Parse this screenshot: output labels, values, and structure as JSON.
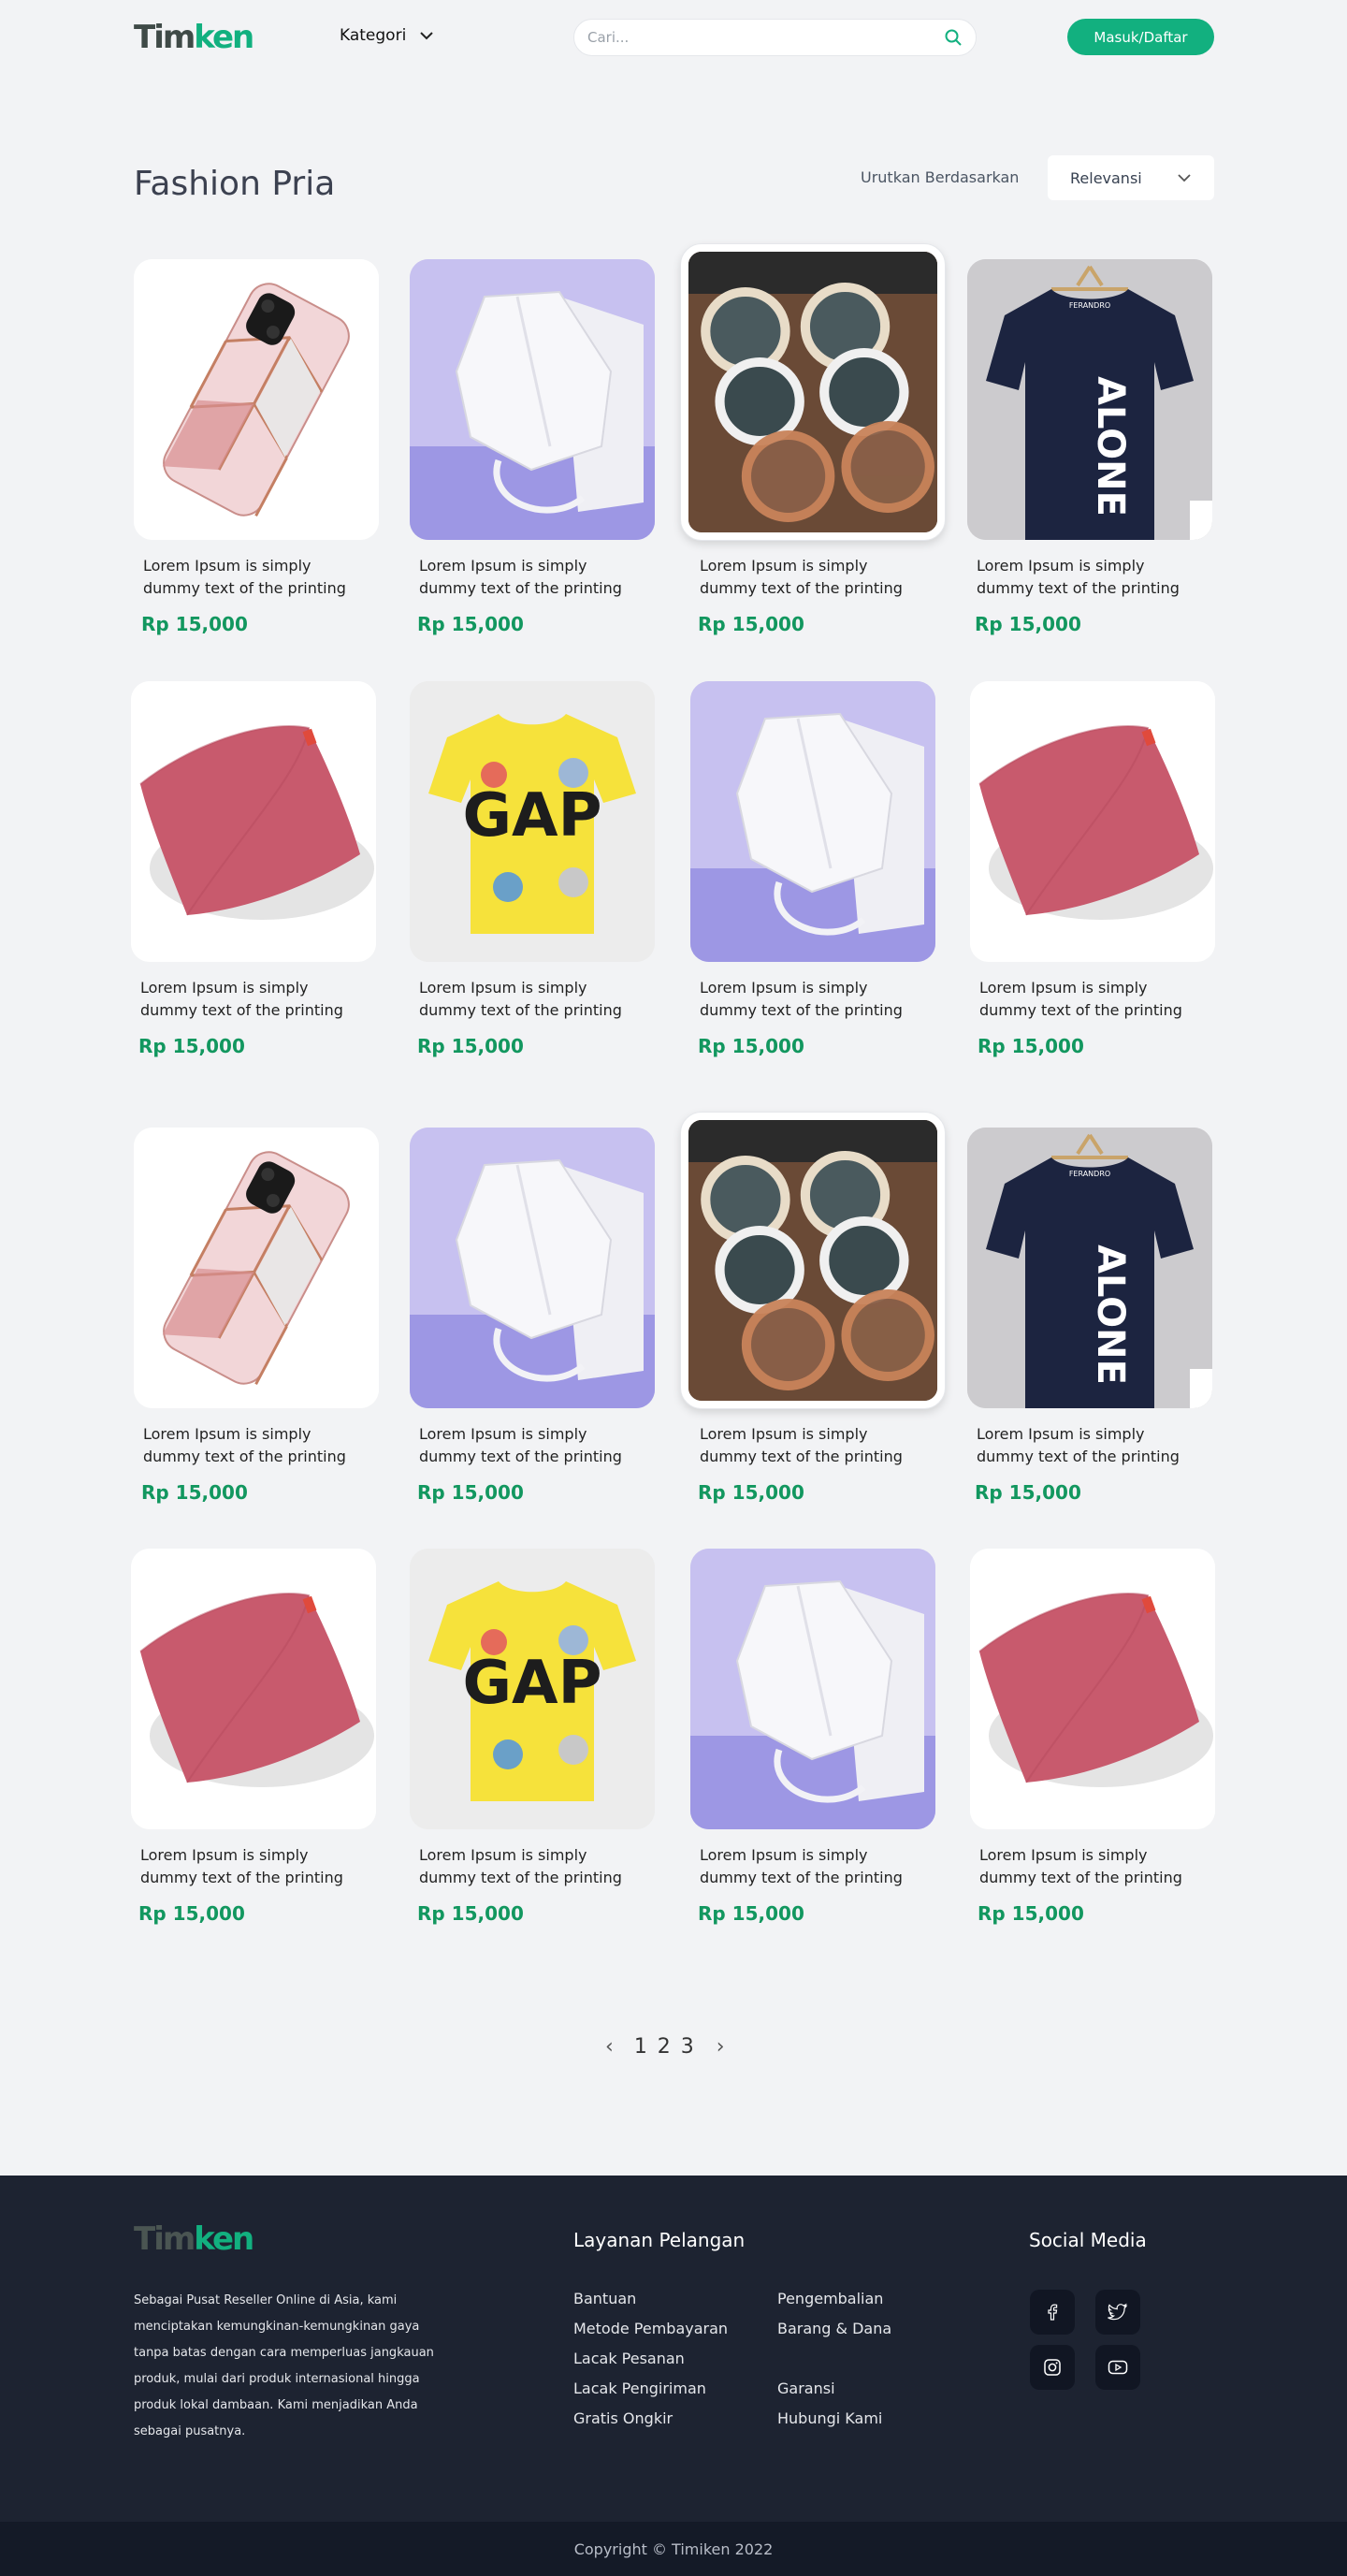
{
  "header": {
    "logo_part1": "Tim",
    "logo_part2": "ken",
    "category_label": "Kategori",
    "search_placeholder": "Cari...",
    "login_label": "Masuk/Daftar"
  },
  "main": {
    "title": "Fashion Pria",
    "sort_label": "Urutkan Berdasarkan",
    "sort_value": "Relevansi"
  },
  "products": [
    {
      "name": "Lorem Ipsum is simply dummy text of the printing",
      "price": "Rp 15,000",
      "image": "phone-case"
    },
    {
      "name": "Lorem Ipsum is simply dummy text of the printing",
      "price": "Rp 15,000",
      "image": "face-mask"
    },
    {
      "name": "Lorem Ipsum is simply dummy text of the printing",
      "price": "Rp 15,000",
      "image": "sunglasses"
    },
    {
      "name": "Lorem Ipsum is simply dummy text of the printing",
      "price": "Rp 15,000",
      "image": "black-tshirt"
    },
    {
      "name": "Lorem Ipsum is simply dummy text of the printing",
      "price": "Rp 15,000",
      "image": "pink-pillow"
    },
    {
      "name": "Lorem Ipsum is simply dummy text of the printing",
      "price": "Rp 15,000",
      "image": "yellow-tshirt"
    },
    {
      "name": "Lorem Ipsum is simply dummy text of the printing",
      "price": "Rp 15,000",
      "image": "face-mask"
    },
    {
      "name": "Lorem Ipsum is simply dummy text of the printing",
      "price": "Rp 15,000",
      "image": "pink-pillow"
    },
    {
      "name": "Lorem Ipsum is simply dummy text of the printing",
      "price": "Rp 15,000",
      "image": "phone-case"
    },
    {
      "name": "Lorem Ipsum is simply dummy text of the printing",
      "price": "Rp 15,000",
      "image": "face-mask"
    },
    {
      "name": "Lorem Ipsum is simply dummy text of the printing",
      "price": "Rp 15,000",
      "image": "sunglasses"
    },
    {
      "name": "Lorem Ipsum is simply dummy text of the printing",
      "price": "Rp 15,000",
      "image": "black-tshirt"
    },
    {
      "name": "Lorem Ipsum is simply dummy text of the printing",
      "price": "Rp 15,000",
      "image": "pink-pillow"
    },
    {
      "name": "Lorem Ipsum is simply dummy text of the printing",
      "price": "Rp 15,000",
      "image": "yellow-tshirt"
    },
    {
      "name": "Lorem Ipsum is simply dummy text of the printing",
      "price": "Rp 15,000",
      "image": "face-mask"
    },
    {
      "name": "Lorem Ipsum is simply dummy text of the printing",
      "price": "Rp 15,000",
      "image": "pink-pillow"
    }
  ],
  "image_text": {
    "tshirt_print": "ALONE",
    "tshirt_brand": "FERANDRO",
    "yellow_tshirt_print": "GAP"
  },
  "pagination": {
    "pages": "1 2 3"
  },
  "footer": {
    "description": "Sebagai Pusat Reseller Online di Asia, kami menciptakan kemungkinan-kemungkinan gaya tanpa batas dengan cara memperluas jangkauan produk, mulai dari produk internasional hingga produk lokal dambaan. Kami menjadikan Anda sebagai pusatnya.",
    "service_heading": "Layanan Pelangan",
    "links": {
      "bantuan": "Bantuan",
      "pengembalian": "Pengembalian",
      "metode": "Metode Pembayaran",
      "barang": "Barang & Dana",
      "lacak_pesanan": "Lacak Pesanan",
      "lacak_pengiriman": "Lacak Pengiriman",
      "garansi": "Garansi",
      "gratis_ongkir": "Gratis Ongkir",
      "hubungi": "Hubungi Kami"
    },
    "social_heading": "Social Media",
    "social": [
      "facebook-icon",
      "twitter-icon",
      "instagram-icon",
      "youtube-icon"
    ],
    "copyright": "Copyright © Timiken 2022"
  },
  "colors": {
    "accent": "#12b07f",
    "price": "#12975f",
    "footer_bg": "#1d2331"
  }
}
